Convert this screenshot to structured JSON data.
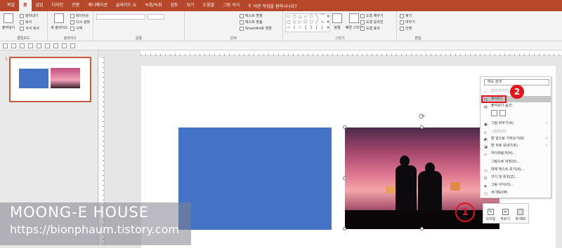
{
  "tabs": [
    "파일",
    "홈",
    "삽입",
    "디자인",
    "전환",
    "애니메이션",
    "슬라이드 쇼",
    "녹음/녹화",
    "검토",
    "보기",
    "도움말",
    "그림 서식"
  ],
  "tell_me": "어떤 작업을 원하시나요?",
  "ribbon": {
    "clipboard": {
      "paste": "붙여넣기",
      "cut": "잘라내기",
      "copy": "복사",
      "format_painter": "서식 복사",
      "label": "클립보드"
    },
    "slides": {
      "new_slide": "새 슬라이드",
      "layout": "레이아웃",
      "reset": "다시 설정",
      "section": "구역",
      "label": "슬라이드"
    },
    "font": {
      "label": "글꼴"
    },
    "paragraph": {
      "text_direction": "텍스트 방향",
      "align_text": "텍스트 맞춤",
      "smartart": "SmartArt로 변환",
      "label": "단락"
    },
    "drawing": {
      "arrange": "정렬",
      "quick_styles": "빠른 스타일",
      "shape_fill": "도형 채우기",
      "shape_outline": "도형 윤곽선",
      "shape_effects": "도형 효과",
      "label": "그리기"
    },
    "editing": {
      "find": "찾기",
      "replace": "바꾸기",
      "select": "선택",
      "label": "편집"
    }
  },
  "thumbnail": {
    "number": "1"
  },
  "context_menu": {
    "search": "메뉴 검색",
    "items": [
      {
        "label": "잘라내기(T)",
        "state": "disabled"
      },
      {
        "label": "복사(C)",
        "state": "highlighted"
      },
      {
        "label": "붙여넣기 옵션:",
        "state": "normal"
      },
      {
        "label": "그림 바꾸기(A)",
        "state": "normal"
      },
      {
        "label": "그룹화(G)",
        "state": "disabled"
      },
      {
        "label": "맨 앞으로 가져오기(R)",
        "state": "normal"
      },
      {
        "label": "맨 뒤로 보내기(K)",
        "state": "normal"
      },
      {
        "label": "하이퍼링크(H)...",
        "state": "normal"
      },
      {
        "label": "그림으로 저장(S)...",
        "state": "normal"
      },
      {
        "label": "대체 텍스트 보기(A)...",
        "state": "normal"
      },
      {
        "label": "크기 및 위치(Z)...",
        "state": "normal"
      },
      {
        "label": "그림 서식(O)...",
        "state": "normal"
      },
      {
        "label": "새 메모(M)",
        "state": "normal"
      }
    ]
  },
  "annotations": {
    "badge_2": "2",
    "circle_1": "1"
  },
  "mini_toolbar": {
    "style": "스타일",
    "crop": "자르기",
    "new_comment": "새 메모"
  },
  "watermark": {
    "title": "MOONG-E HOUSE",
    "url": "https://bionphaum.tistory.com"
  },
  "colors": {
    "accent": "#b7472a",
    "shape_fill": "#4472c4",
    "highlight": "#e3141a"
  }
}
